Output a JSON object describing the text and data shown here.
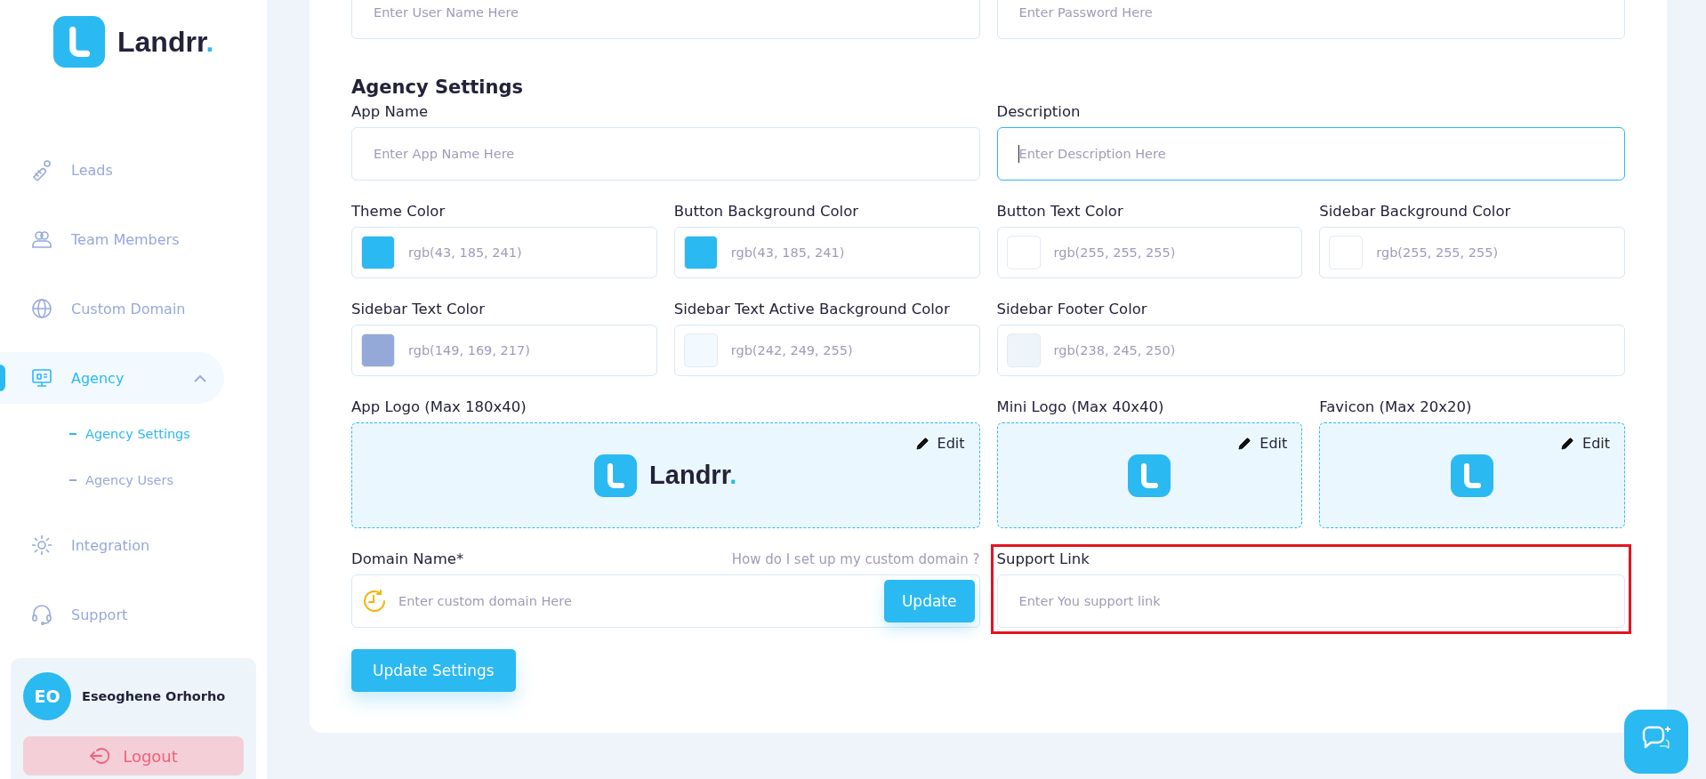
{
  "sidebar": {
    "brand": "Landrr.",
    "nav": [
      {
        "label": "Leads",
        "selected": false
      },
      {
        "label": "Team Members",
        "selected": false
      },
      {
        "label": "Custom Domain",
        "selected": false
      },
      {
        "label": "Agency",
        "selected": true,
        "expanded": true,
        "children": [
          {
            "label": "Agency Settings",
            "selected": true
          },
          {
            "label": "Agency Users",
            "selected": false
          }
        ]
      },
      {
        "label": "Integration",
        "selected": false
      },
      {
        "label": "Support",
        "selected": false
      }
    ],
    "user": {
      "initials": "EO",
      "name": "Eseoghene Orhorho"
    },
    "logout": "Logout"
  },
  "form": {
    "top_fields": [
      {
        "placeholder": "Enter User Name Here"
      },
      {
        "placeholder": "Enter Password Here"
      }
    ],
    "section_title": "Agency Settings",
    "text_fields": [
      {
        "label": "App Name",
        "placeholder": "Enter App Name Here",
        "focused": false
      },
      {
        "label": "Description",
        "placeholder": "Enter Description Here",
        "focused": true
      }
    ],
    "color_fields": [
      {
        "label": "Theme Color",
        "value": "rgb(43, 185, 241)",
        "color": "#2bb9f1"
      },
      {
        "label": "Button Background Color",
        "value": "rgb(43, 185, 241)",
        "color": "#2bb9f1"
      },
      {
        "label": "Button Text Color",
        "value": "rgb(255, 255, 255)",
        "color": "#ffffff"
      },
      {
        "label": "Sidebar Background Color",
        "value": "rgb(255, 255, 255)",
        "color": "#ffffff"
      },
      {
        "label": "Sidebar Text Color",
        "value": "rgb(149, 169, 217)",
        "color": "#95a9d9"
      },
      {
        "label": "Sidebar Text Active Background Color",
        "value": "rgb(242, 249, 255)",
        "color": "#f2f9ff"
      },
      {
        "label": "Sidebar Footer Color",
        "value": "rgb(238, 245, 250)",
        "color": "#eef5fa"
      }
    ],
    "logo_fields": [
      {
        "label": "App Logo (Max 180x40)",
        "kind": "wordmark",
        "logo_text": "Landrr.",
        "edit": "Edit"
      },
      {
        "label": "Mini Logo (Max 40x40)",
        "kind": "mark",
        "edit": "Edit"
      },
      {
        "label": "Favicon (Max 20x20)",
        "kind": "mark",
        "edit": "Edit"
      }
    ],
    "domain": {
      "label": "Domain Name*",
      "help_link": "How do I set up my custom domain ?",
      "placeholder": "Enter custom domain Here",
      "button": "Update"
    },
    "support_link": {
      "label": "Support Link",
      "placeholder": "Enter You support link",
      "highlighted": true
    },
    "submit": "Update Settings"
  }
}
